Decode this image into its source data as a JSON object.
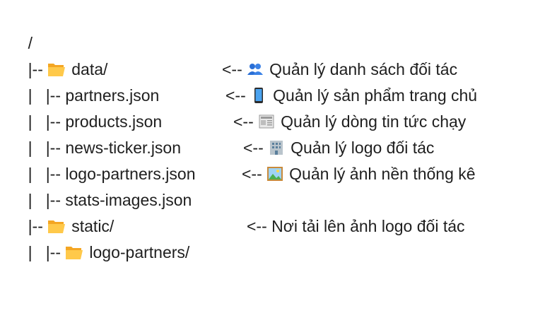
{
  "tree": {
    "root": "/",
    "lines": [
      {
        "prefix": "|-- ",
        "icon": "open-folder-icon",
        "name": "data/"
      },
      {
        "prefix": "|   |-- ",
        "name": "partners.json",
        "arrow": "<--",
        "icon": "busts-in-silhouette-icon",
        "note": "Quản lý danh sách đối tác"
      },
      {
        "prefix": "|   |-- ",
        "name": "products.json",
        "arrow": "<--",
        "icon": "mobile-phone-icon",
        "note": "Quản lý sản phẩm trang chủ"
      },
      {
        "prefix": "|   |-- ",
        "name": "news-ticker.json",
        "arrow": "<--",
        "icon": "newspaper-icon",
        "note": "Quản lý dòng tin tức chạy"
      },
      {
        "prefix": "|   |-- ",
        "name": "logo-partners.json",
        "arrow": "<--",
        "icon": "office-building-icon",
        "note": "Quản lý logo đối tác"
      },
      {
        "prefix": "|   |-- ",
        "name": "stats-images.json",
        "arrow": "<--",
        "icon": "framed-picture-icon",
        "note": "Quản lý ảnh nền thống kê"
      },
      {
        "prefix": "|-- ",
        "icon": "open-folder-icon",
        "name": "static/"
      },
      {
        "prefix": "|   |-- ",
        "icon": "open-folder-icon",
        "name": "logo-partners/",
        "arrow": "<--",
        "note": "Nơi tải lên ảnh logo đối tác"
      }
    ]
  }
}
